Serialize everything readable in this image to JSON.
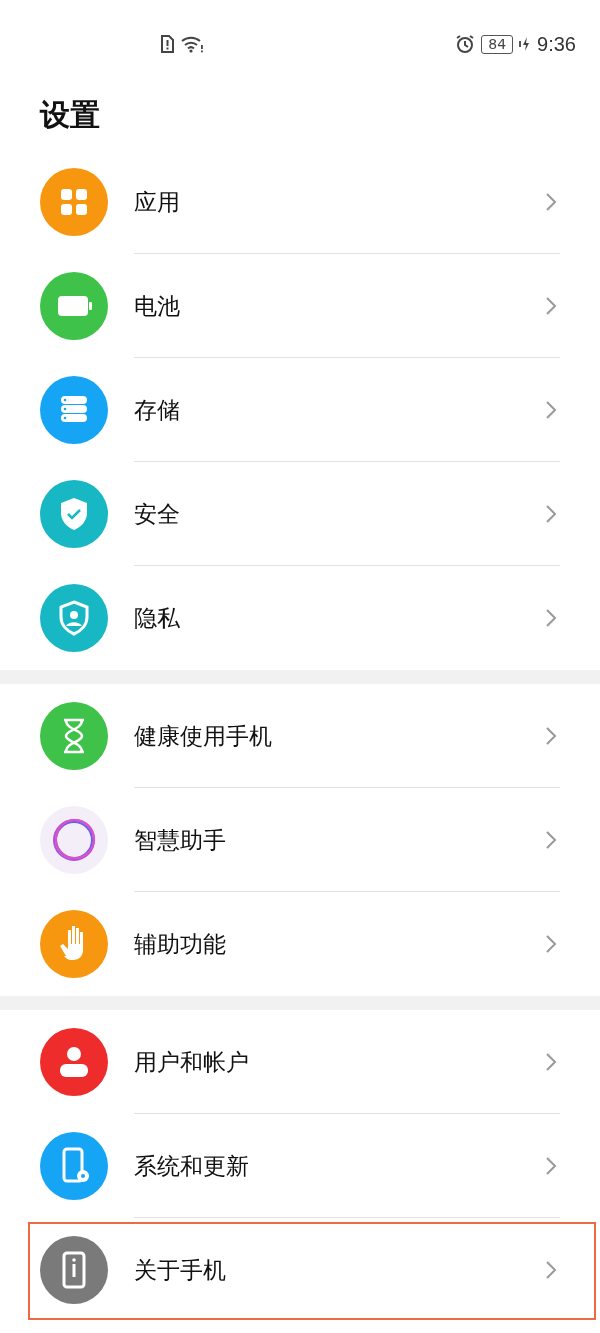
{
  "status_bar": {
    "battery": "84",
    "time": "9:36"
  },
  "title": "设置",
  "groups": [
    {
      "items": [
        {
          "label": "应用",
          "color": "#f7970f",
          "highlighted": false
        },
        {
          "label": "电池",
          "color": "#3fc24a",
          "highlighted": false
        },
        {
          "label": "存储",
          "color": "#16a4f5",
          "highlighted": false
        },
        {
          "label": "安全",
          "color": "#17b8c4",
          "highlighted": false
        },
        {
          "label": "隐私",
          "color": "#17b8c4",
          "highlighted": false
        }
      ]
    },
    {
      "items": [
        {
          "label": "健康使用手机",
          "color": "#3fc24a",
          "highlighted": false
        },
        {
          "label": "智慧助手",
          "color": "#f3eef8",
          "highlighted": false
        },
        {
          "label": "辅助功能",
          "color": "#f7970f",
          "highlighted": false
        }
      ]
    },
    {
      "items": [
        {
          "label": "用户和帐户",
          "color": "#ef2c2c",
          "highlighted": false
        },
        {
          "label": "系统和更新",
          "color": "#16a4f5",
          "highlighted": false
        },
        {
          "label": "关于手机",
          "color": "#7a7a7a",
          "highlighted": true
        }
      ]
    }
  ]
}
